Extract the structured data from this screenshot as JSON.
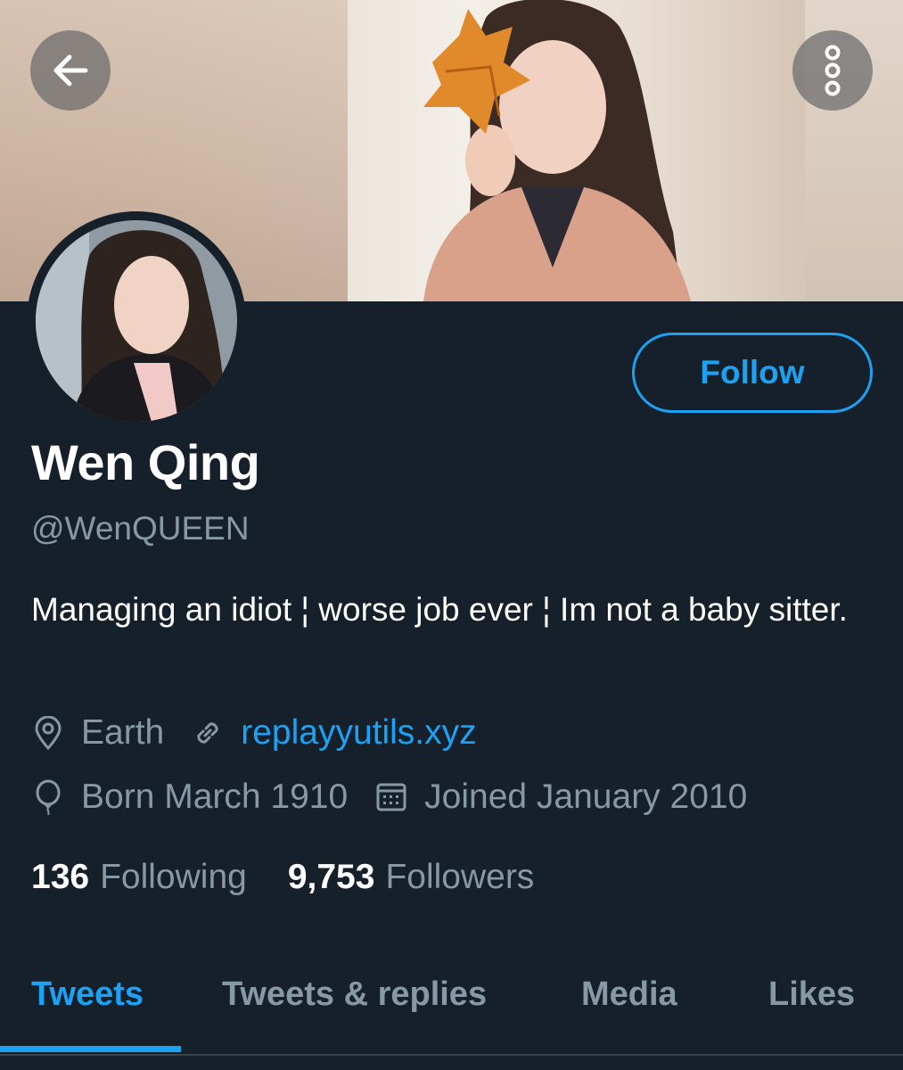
{
  "header": {
    "back_icon": "arrow-left-icon",
    "more_icon": "more-vertical-icon"
  },
  "profile": {
    "display_name": "Wen Qing",
    "handle": "@WenQUEEN",
    "bio": "Managing an idiot ¦ worse job ever ¦ Im not a baby sitter.",
    "follow_label": "Follow",
    "location": "Earth",
    "website": "replayyutils.xyz",
    "birthday": "Born March 1910",
    "joined": "Joined January 2010"
  },
  "stats": {
    "following_count": "136",
    "following_label": "Following",
    "followers_count": "9,753",
    "followers_label": "Followers"
  },
  "tabs": [
    {
      "label": "Tweets",
      "active": true
    },
    {
      "label": "Tweets & replies",
      "active": false
    },
    {
      "label": "Media",
      "active": false
    },
    {
      "label": "Likes",
      "active": false
    }
  ],
  "colors": {
    "background": "#15202b",
    "accent": "#1da1f2",
    "secondary_text": "#8899a6",
    "primary_text": "#ffffff"
  }
}
